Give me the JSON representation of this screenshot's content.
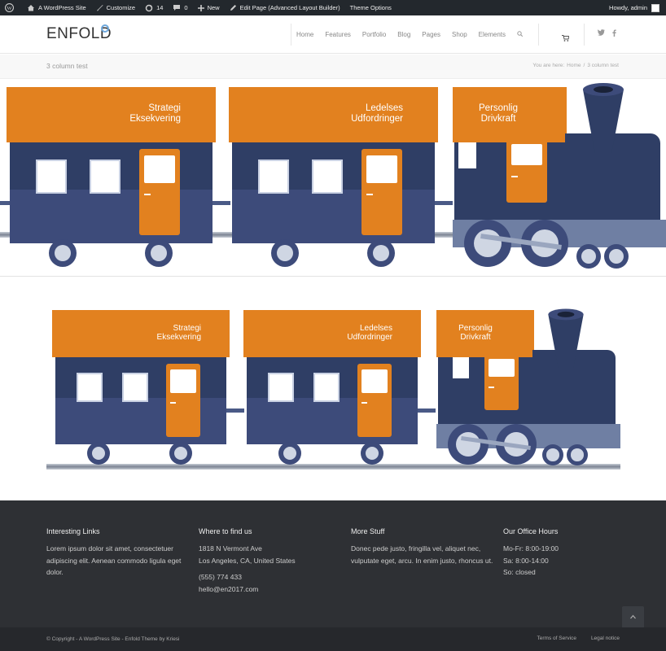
{
  "adminbar": {
    "site": "A WordPress Site",
    "customize": "Customize",
    "updates": "14",
    "comments": "0",
    "new": "New",
    "edit": "Edit Page (Advanced Layout Builder)",
    "theme_options": "Theme Options",
    "howdy": "Howdy, admin"
  },
  "header": {
    "logo": "ENFOLD",
    "nav": [
      "Home",
      "Features",
      "Portfolio",
      "Blog",
      "Pages",
      "Shop",
      "Elements"
    ]
  },
  "titlebar": {
    "title": "3 column test",
    "you_are_here": "You are here:",
    "home": "Home",
    "sep": "/",
    "current": "3 column test"
  },
  "train": {
    "car1_line1": "Strategi",
    "car1_line2": "Eksekvering",
    "car2_line1": "Ledelses",
    "car2_line2": "Udfordringer",
    "car3_line1": "Personlig",
    "car3_line2": "Drivkraft"
  },
  "footer": {
    "col1": {
      "title": "Interesting Links",
      "text": "Lorem ipsum dolor sit amet, consectetuer adipiscing elit. Aenean commodo ligula eget dolor."
    },
    "col2": {
      "title": "Where to find us",
      "addr1": "1818 N Vermont Ave",
      "addr2": "Los Angeles, CA, United States",
      "phone": "(555) 774 433",
      "email": "hello@en2017.com"
    },
    "col3": {
      "title": "More Stuff",
      "text": "Donec pede justo, fringilla vel, aliquet nec, vulputate eget, arcu. In enim justo, rhoncus ut."
    },
    "col4": {
      "title": "Our Office Hours",
      "line1": "Mo-Fr: 8:00-19:00",
      "line2": "Sa: 8:00-14:00",
      "line3": "So: closed"
    }
  },
  "socket": {
    "copyright": "© Copyright - A WordPress Site - Enfold Theme by Kriesi",
    "terms": "Terms of Service",
    "legal": "Legal notice"
  },
  "colors": {
    "accent": "#e2811f",
    "train_dark": "#2f3e65",
    "footer_bg": "#2e3034"
  }
}
